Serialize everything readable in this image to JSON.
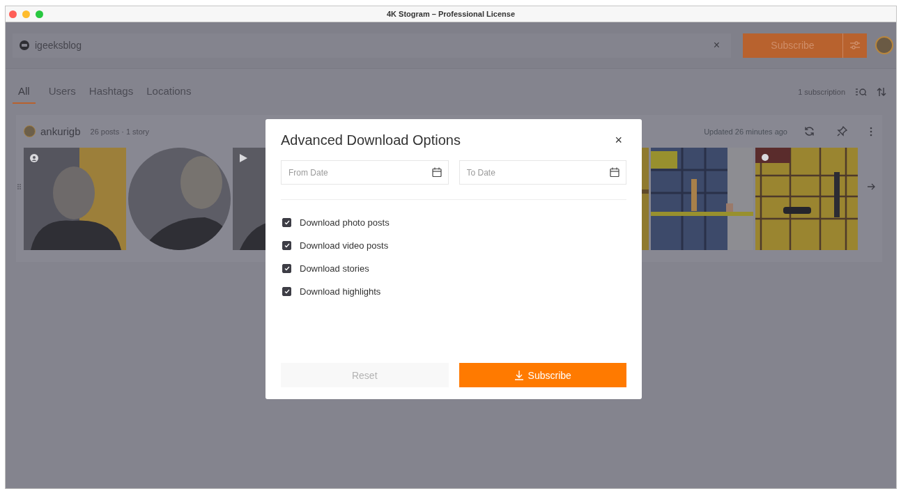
{
  "window": {
    "title": "4K Stogram – Professional License"
  },
  "search": {
    "value": "igeeksblog",
    "clear": "×"
  },
  "subscribe_button": "Subscribe",
  "tabs": [
    {
      "label": "All",
      "selected": true
    },
    {
      "label": "Users",
      "selected": false
    },
    {
      "label": "Hashtags",
      "selected": false
    },
    {
      "label": "Locations",
      "selected": false
    }
  ],
  "subscription_count": "1 subscription",
  "subscription": {
    "name": "ankurigb",
    "meta": "26 posts · 1 story",
    "updated": "Updated 26 minutes ago",
    "posts": [
      {
        "kind": "profile"
      },
      {
        "kind": "round"
      },
      {
        "kind": "video"
      },
      {
        "kind": "hidden"
      },
      {
        "kind": "hidden"
      },
      {
        "kind": "edge"
      },
      {
        "kind": "shelf"
      },
      {
        "kind": "grid"
      }
    ]
  },
  "dialog": {
    "title": "Advanced Download Options",
    "close": "×",
    "from_date": {
      "placeholder": "From Date"
    },
    "to_date": {
      "placeholder": "To Date"
    },
    "options": [
      {
        "label": "Download photo posts",
        "checked": true
      },
      {
        "label": "Download video posts",
        "checked": true
      },
      {
        "label": "Download stories",
        "checked": true
      },
      {
        "label": "Download highlights",
        "checked": true
      }
    ],
    "reset": "Reset",
    "subscribe": "Subscribe"
  }
}
